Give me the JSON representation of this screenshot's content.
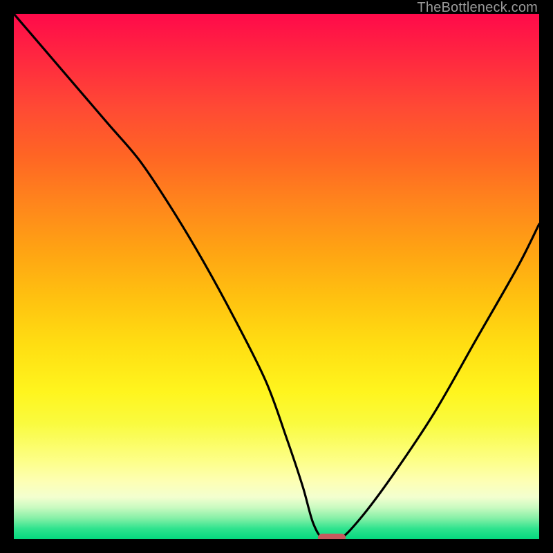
{
  "watermark": "TheBottleneck.com",
  "chart_data": {
    "type": "line",
    "title": "",
    "xlabel": "",
    "ylabel": "",
    "xlim": [
      0,
      100
    ],
    "ylim": [
      0,
      100
    ],
    "grid": false,
    "legend": false,
    "series": [
      {
        "name": "bottleneck-curve",
        "x": [
          0,
          6,
          12,
          18,
          24,
          30,
          36,
          42,
          48,
          52,
          55,
          57,
          59,
          62,
          66,
          72,
          80,
          88,
          96,
          100
        ],
        "y": [
          100,
          93,
          86,
          79,
          72,
          63,
          53,
          42,
          30,
          19,
          10,
          3,
          0,
          0,
          4,
          12,
          24,
          38,
          52,
          60
        ]
      }
    ],
    "marker": {
      "x": 60.5,
      "y": 0,
      "width_pct": 5.2,
      "height_pct": 1.6,
      "color": "#c75a5e"
    },
    "background_gradient_stops": [
      "#ff0a4a",
      "#ff2a3f",
      "#ff4a34",
      "#ff6524",
      "#ff851c",
      "#ffa313",
      "#ffc110",
      "#ffde12",
      "#fff51e",
      "#f9fb3f",
      "#fdff87",
      "#fdffb4",
      "#f3ffcf",
      "#c8fac0",
      "#86f0a7",
      "#2fe38e",
      "#04d97f"
    ]
  }
}
